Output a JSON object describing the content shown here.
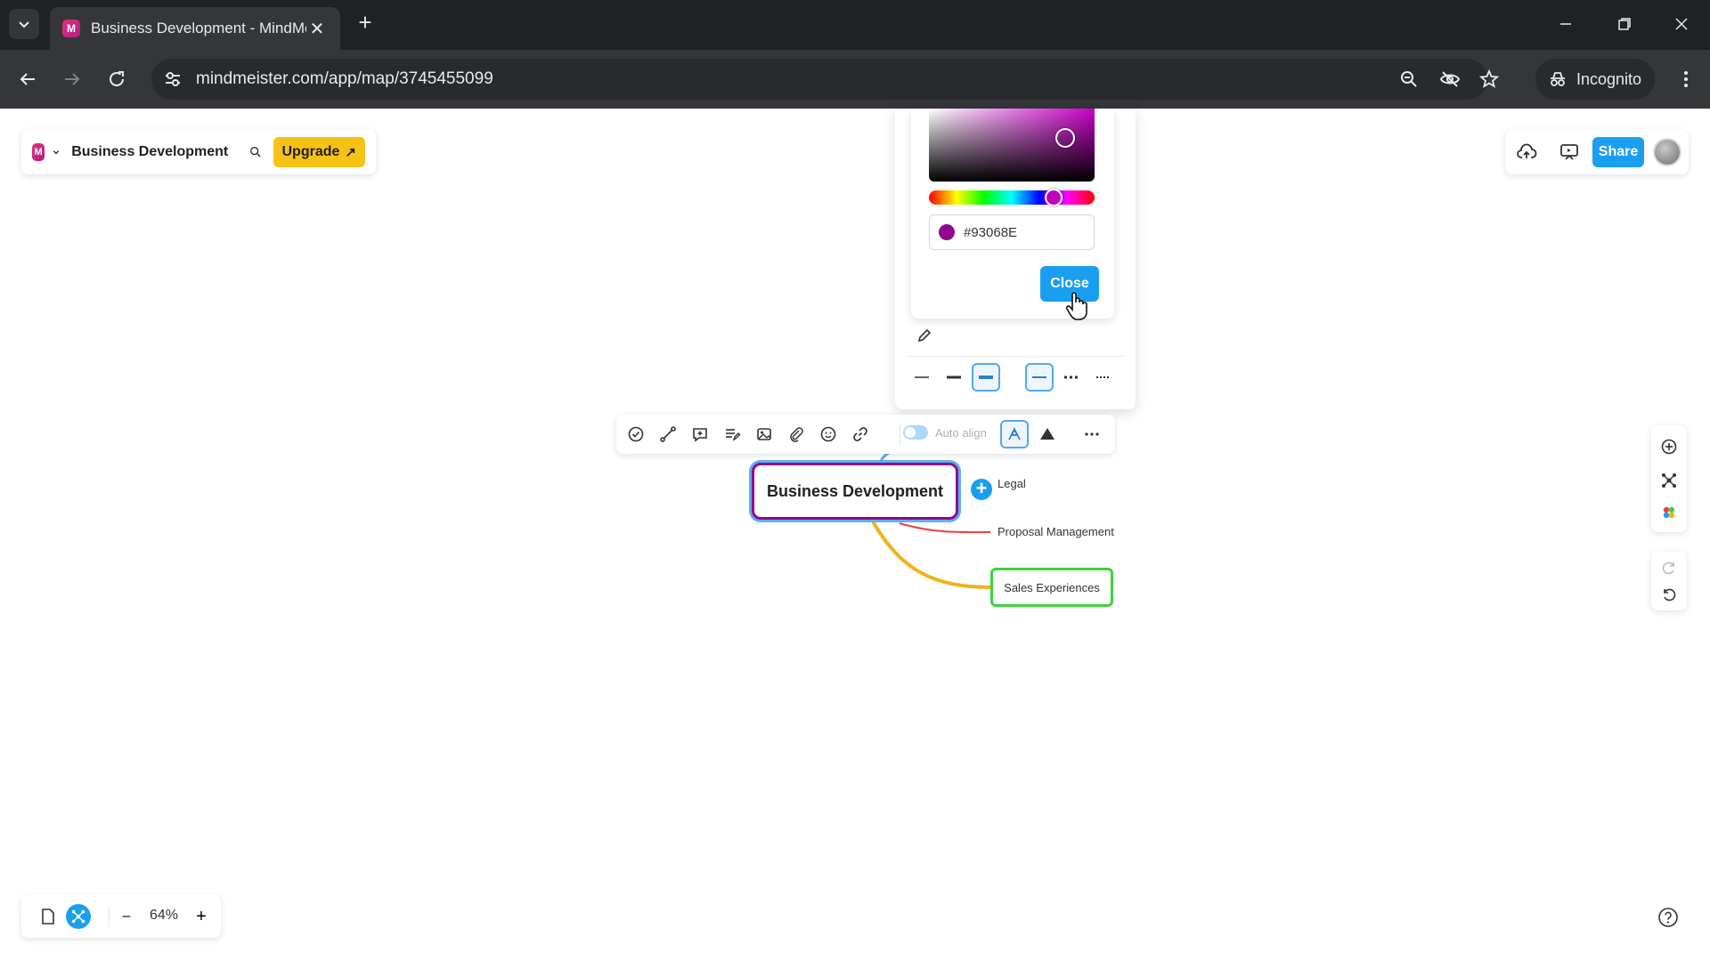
{
  "browser": {
    "tab_title": "Business Development - MindMeister",
    "url": "mindmeister.com/app/map/3745455099",
    "incognito_label": "Incognito",
    "new_tab_symbol": "+",
    "close_symbol": "✕"
  },
  "app": {
    "map_title": "Business Development",
    "logo_letter": "M",
    "upgrade_label": "Upgrade",
    "upgrade_arrow": "↗",
    "share_label": "Share"
  },
  "color_picker": {
    "hex_value": "#93068E",
    "close_label": "Close",
    "selected_color": "#93068E",
    "hue_color": "#c000c0"
  },
  "topic_toolbar": {
    "auto_align_label": "Auto align"
  },
  "map": {
    "root": {
      "label": "Business Development",
      "border_color": "#93068E"
    },
    "children": [
      {
        "label": "Legal",
        "branch_color": "#5ab0f0"
      },
      {
        "label": "Proposal Management",
        "branch_color": "#e84040"
      },
      {
        "label": "Sales Experiences",
        "branch_color": "#f2b21b",
        "border_color": "#3ed13e"
      }
    ]
  },
  "zoom": {
    "value": "64%",
    "minus": "–",
    "plus": "+"
  },
  "icons": {
    "tab_search": "chevron-down-icon",
    "back": "back-arrow-icon",
    "forward": "forward-arrow-icon",
    "reload": "reload-icon",
    "site_info": "tune-icon",
    "zoom": "magnifier-icon",
    "tracking": "eye-off-icon",
    "bookmark": "star-icon"
  }
}
